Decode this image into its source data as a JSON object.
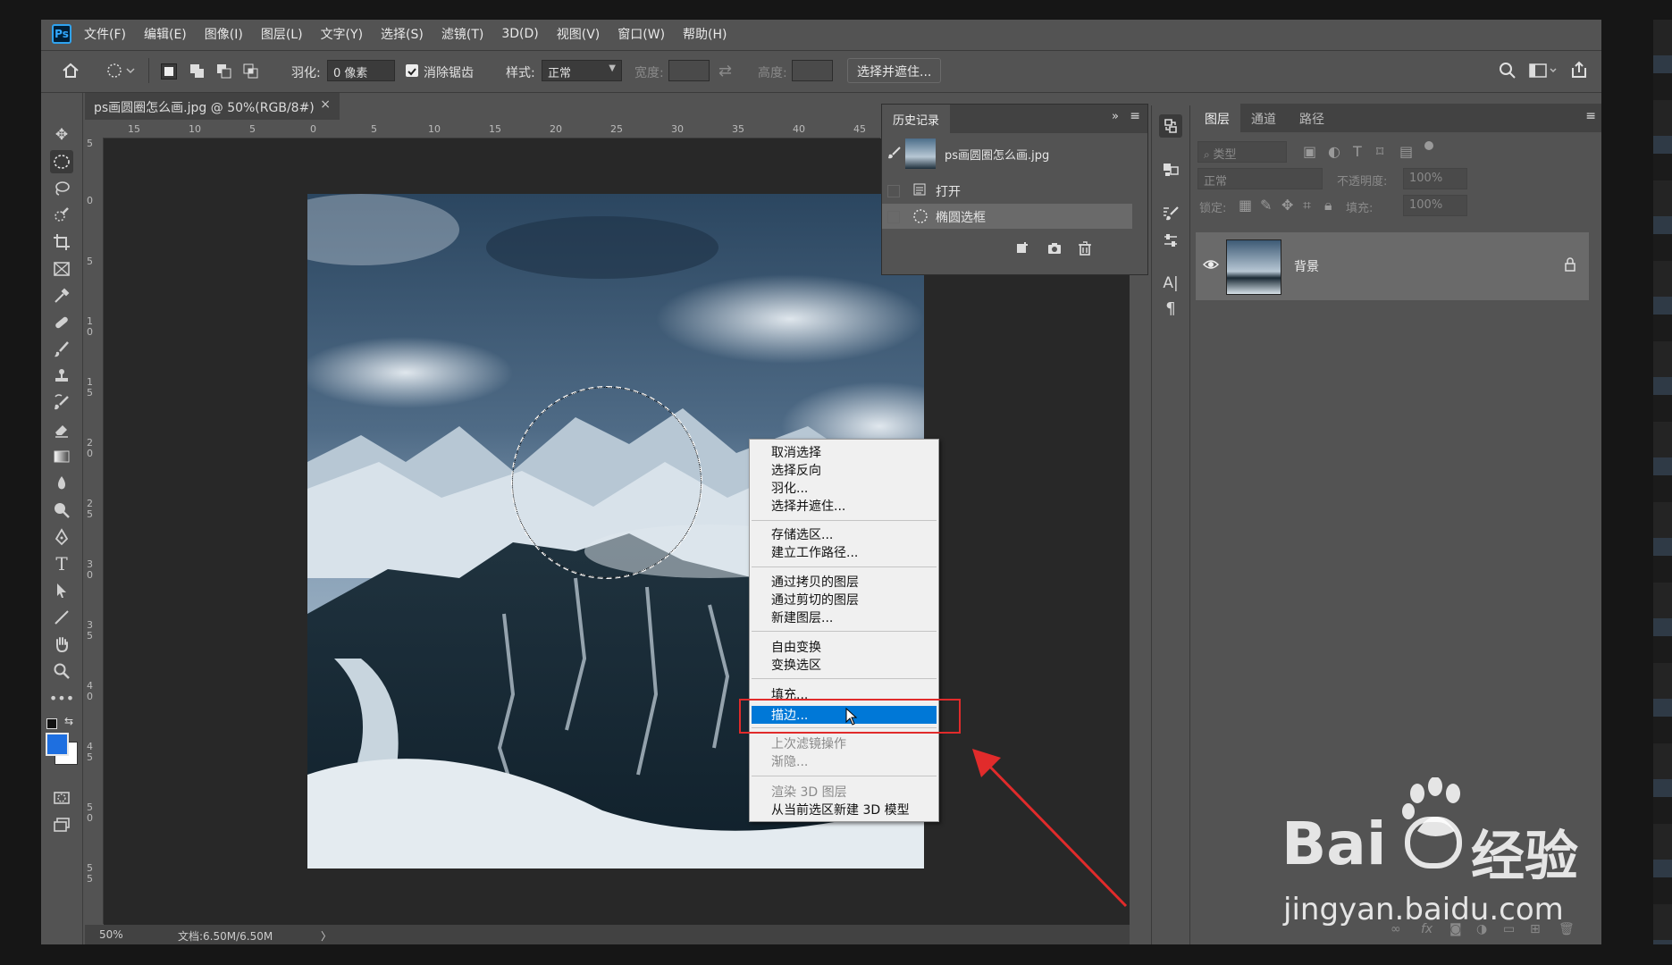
{
  "app": {
    "logo": "Ps"
  },
  "menu": [
    "文件(F)",
    "编辑(E)",
    "图像(I)",
    "图层(L)",
    "文字(Y)",
    "选择(S)",
    "滤镜(T)",
    "3D(D)",
    "视图(V)",
    "窗口(W)",
    "帮助(H)"
  ],
  "options": {
    "feather_label": "羽化:",
    "feather_value": "0 像素",
    "antialias_label": "消除锯齿",
    "style_label": "样式:",
    "style_value": "正常",
    "width_label": "宽度:",
    "height_label": "高度:",
    "select_mask_button": "选择并遮住..."
  },
  "document": {
    "tab_title": "ps画圆圈怎么画.jpg @ 50%(RGB/8#)",
    "close_symbol": "×",
    "zoom": "50%",
    "doc_size": "文档:6.50M/6.50M",
    "ruler_top": [
      "15",
      "10",
      "5",
      "0",
      "5",
      "10",
      "15",
      "20",
      "25",
      "30",
      "35",
      "40",
      "45"
    ],
    "ruler_left": [
      "5",
      "0",
      "5",
      "1 0",
      "1 5",
      "2 0",
      "2 5",
      "3 0",
      "3 5",
      "4 0",
      "4 5",
      "5 0",
      "5 5"
    ]
  },
  "history": {
    "tab": "历史记录",
    "snapshot": "ps画圆圈怎么画.jpg",
    "items": [
      "打开",
      "椭圆选框"
    ],
    "selected_index": 1
  },
  "layers": {
    "tabs": [
      "图层",
      "通道",
      "路径"
    ],
    "filter_kind": "类型",
    "blend_mode": "正常",
    "opacity_label": "不透明度:",
    "opacity_value": "100%",
    "lock_label": "锁定:",
    "fill_label": "填充:",
    "fill_value": "100%",
    "layer_name": "背景",
    "footer_icons": [
      "link-icon",
      "fx-icon",
      "mask-icon",
      "adjustment-icon",
      "folder-icon",
      "new-layer-icon",
      "trash-icon"
    ]
  },
  "context_menu": {
    "items": [
      {
        "label": "取消选择",
        "enabled": true
      },
      {
        "label": "选择反向",
        "enabled": true
      },
      {
        "label": "羽化...",
        "enabled": true
      },
      {
        "label": "选择并遮住...",
        "enabled": true
      },
      {
        "label": "存储选区...",
        "enabled": true
      },
      {
        "label": "建立工作路径...",
        "enabled": true
      },
      {
        "label": "通过拷贝的图层",
        "enabled": true
      },
      {
        "label": "通过剪切的图层",
        "enabled": true
      },
      {
        "label": "新建图层...",
        "enabled": true
      },
      {
        "label": "自由变换",
        "enabled": true
      },
      {
        "label": "变换选区",
        "enabled": true
      },
      {
        "label": "填充...",
        "enabled": true
      },
      {
        "label": "描边...",
        "enabled": true,
        "highlighted": true
      },
      {
        "label": "上次滤镜操作",
        "enabled": false
      },
      {
        "label": "渐隐...",
        "enabled": false
      },
      {
        "label": "渲染 3D 图层",
        "enabled": false
      },
      {
        "label": "从当前选区新建 3D 模型",
        "enabled": true
      }
    ]
  },
  "watermark": {
    "brand": "Bai",
    "brand_cn": "经验",
    "url": "jingyan.baidu.com"
  },
  "colors": {
    "accent": "#0078d7",
    "annotation": "#e12b2b",
    "foreground_swatch": "#1e6fe0",
    "background_swatch": "#ffffff"
  }
}
